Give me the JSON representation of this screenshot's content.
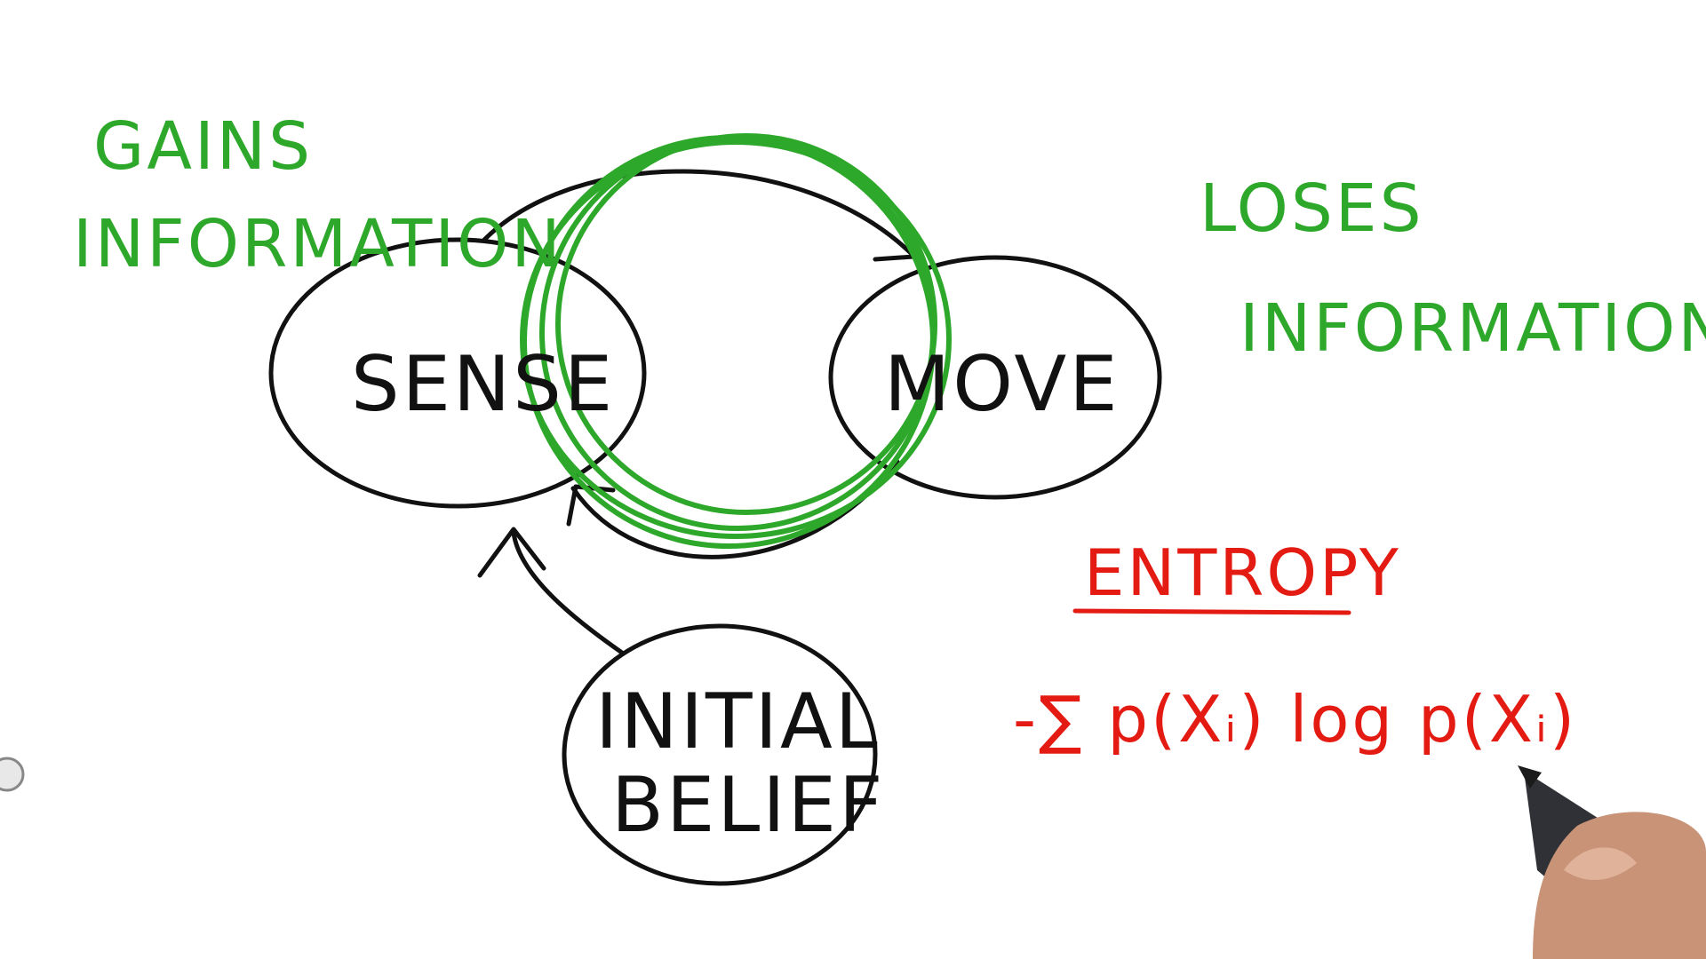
{
  "nodes": {
    "sense": "SENSE",
    "move": "MOVE",
    "initial_belief_line1": "INITIAL",
    "initial_belief_line2": "BELIEF"
  },
  "annotations": {
    "gains_line1": "GAINS",
    "gains_line2": "INFORMATION",
    "loses_line1": "LOSES",
    "loses_line2": "INFORMATION",
    "entropy_title": "ENTROPY",
    "entropy_formula": "-∑ p(Xᵢ) log p(Xᵢ)"
  },
  "colors": {
    "ink": "#111111",
    "green": "#2ea82b",
    "red": "#e31b12"
  }
}
